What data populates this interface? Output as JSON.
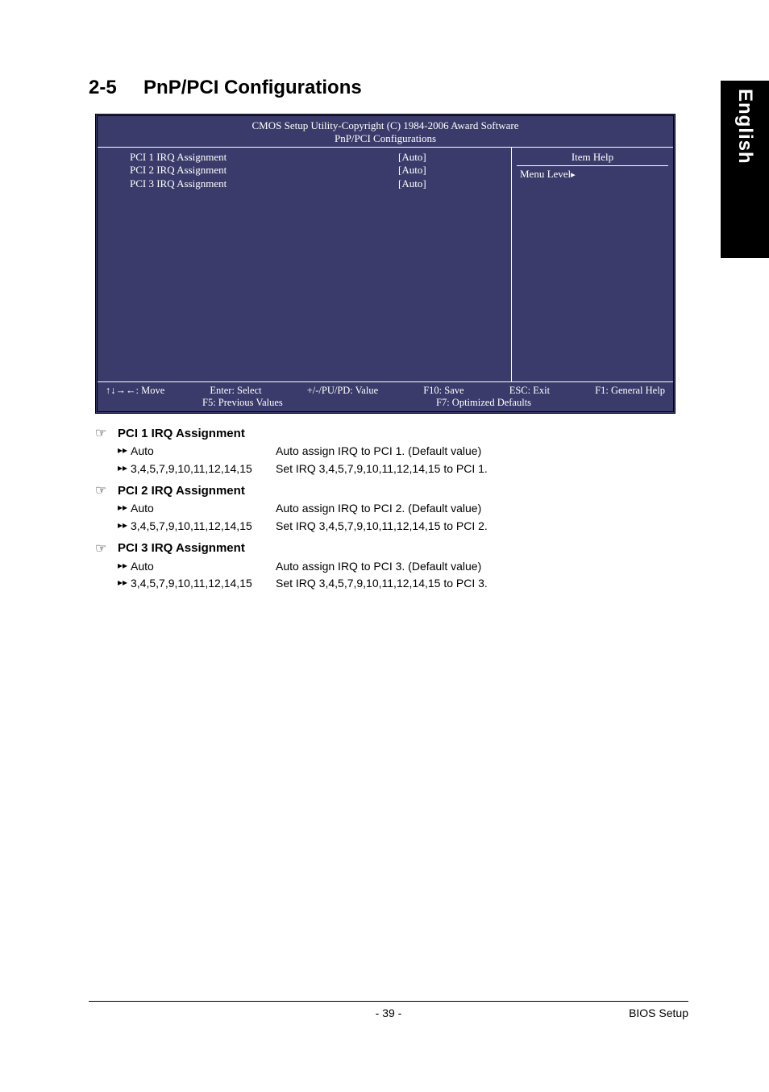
{
  "sideTab": "English",
  "sectionNumber": "2-5",
  "sectionTitle": "PnP/PCI Configurations",
  "bios": {
    "titleLine1": "CMOS Setup Utility-Copyright (C) 1984-2006 Award Software",
    "titleLine2": "PnP/PCI Configurations",
    "rows": [
      {
        "label": "PCI 1 IRQ Assignment",
        "value": "[Auto]"
      },
      {
        "label": "PCI 2 IRQ Assignment",
        "value": "[Auto]"
      },
      {
        "label": "PCI 3 IRQ Assignment",
        "value": "[Auto]"
      }
    ],
    "help": {
      "title": "Item Help",
      "menuLevel": "Menu Level"
    },
    "footer": {
      "move": "↑↓→←: Move",
      "enter": "Enter: Select",
      "value": "+/-/PU/PD: Value",
      "save": "F10: Save",
      "exit": "ESC: Exit",
      "help": "F1: General Help",
      "prev": "F5: Previous Values",
      "defaults": "F7: Optimized Defaults"
    }
  },
  "descriptions": [
    {
      "title": "PCI 1 IRQ Assignment",
      "options": [
        {
          "name": "Auto",
          "desc": "Auto assign IRQ to PCI 1. (Default value)"
        },
        {
          "name": "3,4,5,7,9,10,11,12,14,15",
          "desc": "Set IRQ 3,4,5,7,9,10,11,12,14,15 to PCI 1."
        }
      ]
    },
    {
      "title": "PCI 2 IRQ Assignment",
      "options": [
        {
          "name": "Auto",
          "desc": "Auto assign IRQ to PCI 2. (Default value)"
        },
        {
          "name": "3,4,5,7,9,10,11,12,14,15",
          "desc": "Set IRQ 3,4,5,7,9,10,11,12,14,15 to PCI 2."
        }
      ]
    },
    {
      "title": "PCI 3 IRQ Assignment",
      "options": [
        {
          "name": "Auto",
          "desc": "Auto assign IRQ to PCI 3. (Default value)"
        },
        {
          "name": "3,4,5,7,9,10,11,12,14,15",
          "desc": "Set IRQ 3,4,5,7,9,10,11,12,14,15 to PCI 3."
        }
      ]
    }
  ],
  "pageNumber": "- 39 -",
  "footerRight": "BIOS Setup",
  "bullets": {
    "hand": "☞",
    "double": "▸▸",
    "single": "▸"
  }
}
